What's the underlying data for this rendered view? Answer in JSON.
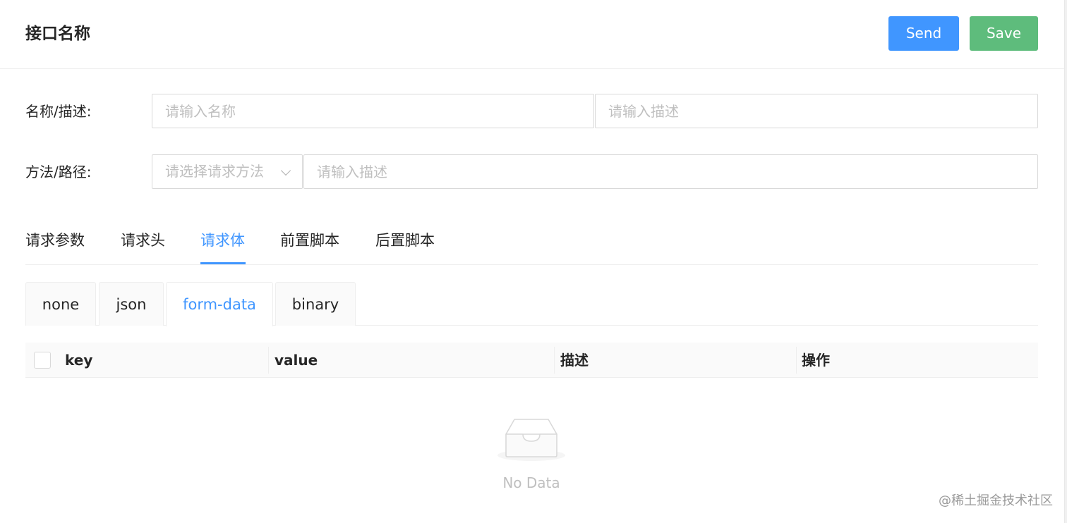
{
  "header": {
    "title": "接口名称",
    "send_label": "Send",
    "save_label": "Save"
  },
  "form": {
    "name_row": {
      "label": "名称/描述:",
      "name_placeholder": "请输入名称",
      "desc_placeholder": "请输入描述"
    },
    "method_row": {
      "label": "方法/路径:",
      "method_placeholder": "请选择请求方法",
      "path_placeholder": "请输入描述"
    }
  },
  "tabs": {
    "items": [
      "请求参数",
      "请求头",
      "请求体",
      "前置脚本",
      "后置脚本"
    ],
    "active": "请求体"
  },
  "body_types": {
    "items": [
      "none",
      "json",
      "form-data",
      "binary"
    ],
    "active": "form-data"
  },
  "table": {
    "columns": [
      "key",
      "value",
      "描述",
      "操作"
    ],
    "empty_text": "No Data"
  },
  "watermark": "@稀土掘金技术社区",
  "colors": {
    "primary": "#4096ff",
    "save_green": "#5ebc7c"
  }
}
